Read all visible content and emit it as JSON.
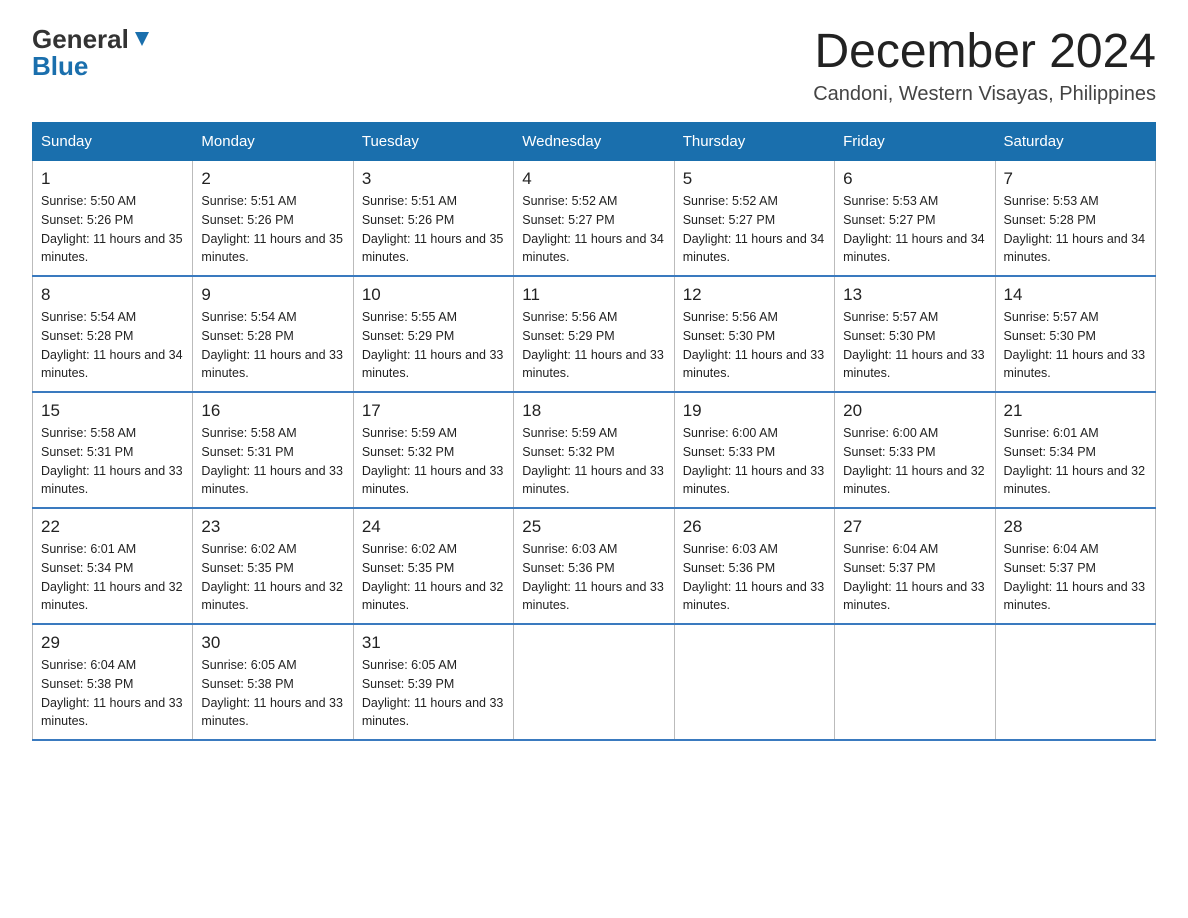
{
  "logo": {
    "text_part1": "General",
    "text_part2": "Blue"
  },
  "title": "December 2024",
  "subtitle": "Candoni, Western Visayas, Philippines",
  "days_of_week": [
    "Sunday",
    "Monday",
    "Tuesday",
    "Wednesday",
    "Thursday",
    "Friday",
    "Saturday"
  ],
  "weeks": [
    [
      {
        "day": "1",
        "sunrise": "5:50 AM",
        "sunset": "5:26 PM",
        "daylight": "11 hours and 35 minutes."
      },
      {
        "day": "2",
        "sunrise": "5:51 AM",
        "sunset": "5:26 PM",
        "daylight": "11 hours and 35 minutes."
      },
      {
        "day": "3",
        "sunrise": "5:51 AM",
        "sunset": "5:26 PM",
        "daylight": "11 hours and 35 minutes."
      },
      {
        "day": "4",
        "sunrise": "5:52 AM",
        "sunset": "5:27 PM",
        "daylight": "11 hours and 34 minutes."
      },
      {
        "day": "5",
        "sunrise": "5:52 AM",
        "sunset": "5:27 PM",
        "daylight": "11 hours and 34 minutes."
      },
      {
        "day": "6",
        "sunrise": "5:53 AM",
        "sunset": "5:27 PM",
        "daylight": "11 hours and 34 minutes."
      },
      {
        "day": "7",
        "sunrise": "5:53 AM",
        "sunset": "5:28 PM",
        "daylight": "11 hours and 34 minutes."
      }
    ],
    [
      {
        "day": "8",
        "sunrise": "5:54 AM",
        "sunset": "5:28 PM",
        "daylight": "11 hours and 34 minutes."
      },
      {
        "day": "9",
        "sunrise": "5:54 AM",
        "sunset": "5:28 PM",
        "daylight": "11 hours and 33 minutes."
      },
      {
        "day": "10",
        "sunrise": "5:55 AM",
        "sunset": "5:29 PM",
        "daylight": "11 hours and 33 minutes."
      },
      {
        "day": "11",
        "sunrise": "5:56 AM",
        "sunset": "5:29 PM",
        "daylight": "11 hours and 33 minutes."
      },
      {
        "day": "12",
        "sunrise": "5:56 AM",
        "sunset": "5:30 PM",
        "daylight": "11 hours and 33 minutes."
      },
      {
        "day": "13",
        "sunrise": "5:57 AM",
        "sunset": "5:30 PM",
        "daylight": "11 hours and 33 minutes."
      },
      {
        "day": "14",
        "sunrise": "5:57 AM",
        "sunset": "5:30 PM",
        "daylight": "11 hours and 33 minutes."
      }
    ],
    [
      {
        "day": "15",
        "sunrise": "5:58 AM",
        "sunset": "5:31 PM",
        "daylight": "11 hours and 33 minutes."
      },
      {
        "day": "16",
        "sunrise": "5:58 AM",
        "sunset": "5:31 PM",
        "daylight": "11 hours and 33 minutes."
      },
      {
        "day": "17",
        "sunrise": "5:59 AM",
        "sunset": "5:32 PM",
        "daylight": "11 hours and 33 minutes."
      },
      {
        "day": "18",
        "sunrise": "5:59 AM",
        "sunset": "5:32 PM",
        "daylight": "11 hours and 33 minutes."
      },
      {
        "day": "19",
        "sunrise": "6:00 AM",
        "sunset": "5:33 PM",
        "daylight": "11 hours and 33 minutes."
      },
      {
        "day": "20",
        "sunrise": "6:00 AM",
        "sunset": "5:33 PM",
        "daylight": "11 hours and 32 minutes."
      },
      {
        "day": "21",
        "sunrise": "6:01 AM",
        "sunset": "5:34 PM",
        "daylight": "11 hours and 32 minutes."
      }
    ],
    [
      {
        "day": "22",
        "sunrise": "6:01 AM",
        "sunset": "5:34 PM",
        "daylight": "11 hours and 32 minutes."
      },
      {
        "day": "23",
        "sunrise": "6:02 AM",
        "sunset": "5:35 PM",
        "daylight": "11 hours and 32 minutes."
      },
      {
        "day": "24",
        "sunrise": "6:02 AM",
        "sunset": "5:35 PM",
        "daylight": "11 hours and 32 minutes."
      },
      {
        "day": "25",
        "sunrise": "6:03 AM",
        "sunset": "5:36 PM",
        "daylight": "11 hours and 33 minutes."
      },
      {
        "day": "26",
        "sunrise": "6:03 AM",
        "sunset": "5:36 PM",
        "daylight": "11 hours and 33 minutes."
      },
      {
        "day": "27",
        "sunrise": "6:04 AM",
        "sunset": "5:37 PM",
        "daylight": "11 hours and 33 minutes."
      },
      {
        "day": "28",
        "sunrise": "6:04 AM",
        "sunset": "5:37 PM",
        "daylight": "11 hours and 33 minutes."
      }
    ],
    [
      {
        "day": "29",
        "sunrise": "6:04 AM",
        "sunset": "5:38 PM",
        "daylight": "11 hours and 33 minutes."
      },
      {
        "day": "30",
        "sunrise": "6:05 AM",
        "sunset": "5:38 PM",
        "daylight": "11 hours and 33 minutes."
      },
      {
        "day": "31",
        "sunrise": "6:05 AM",
        "sunset": "5:39 PM",
        "daylight": "11 hours and 33 minutes."
      },
      null,
      null,
      null,
      null
    ]
  ]
}
